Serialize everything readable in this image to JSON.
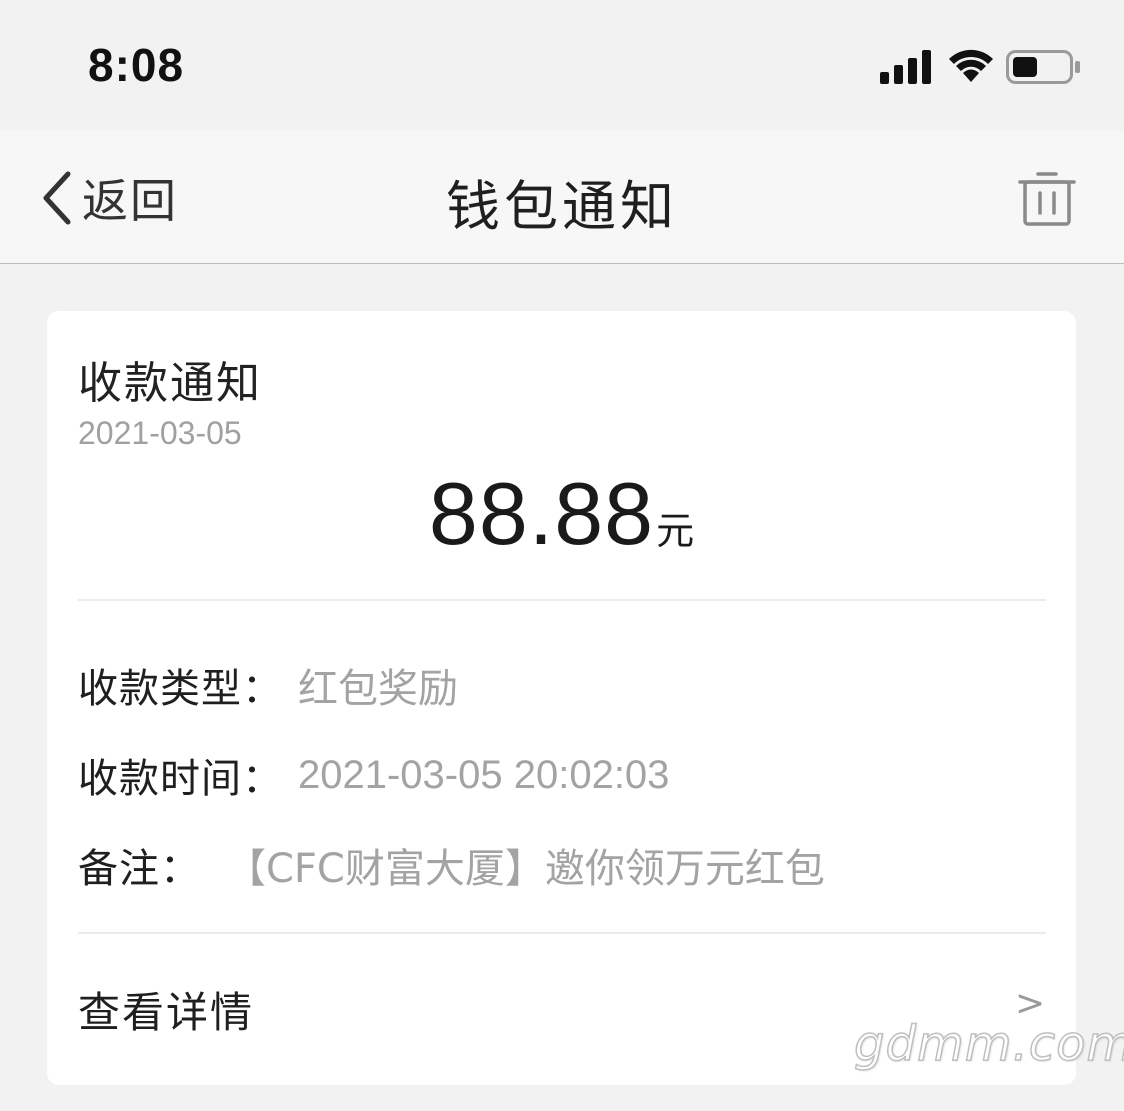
{
  "status_bar": {
    "time": "8:08",
    "icons": [
      "signal-icon",
      "wifi-icon",
      "battery-icon"
    ]
  },
  "nav": {
    "back_label": "返回",
    "title": "钱包通知",
    "trash_icon": "trash-icon"
  },
  "card": {
    "title": "收款通知",
    "date": "2021-03-05",
    "amount": "88.88",
    "amount_unit": "元",
    "rows": [
      {
        "label": "收款类型：",
        "value": "红包奖励"
      },
      {
        "label": "收款时间：",
        "value": "2021-03-05 20:02:03"
      },
      {
        "label": "备注：",
        "value": "【CFC财富大厦】邀你领万元红包"
      }
    ],
    "detail_label": "查看详情",
    "detail_arrow": ">"
  },
  "watermark": "gdmm.com",
  "colors": {
    "background": "#f2f2f2",
    "card": "#ffffff",
    "muted_text": "#a3a3a3"
  }
}
